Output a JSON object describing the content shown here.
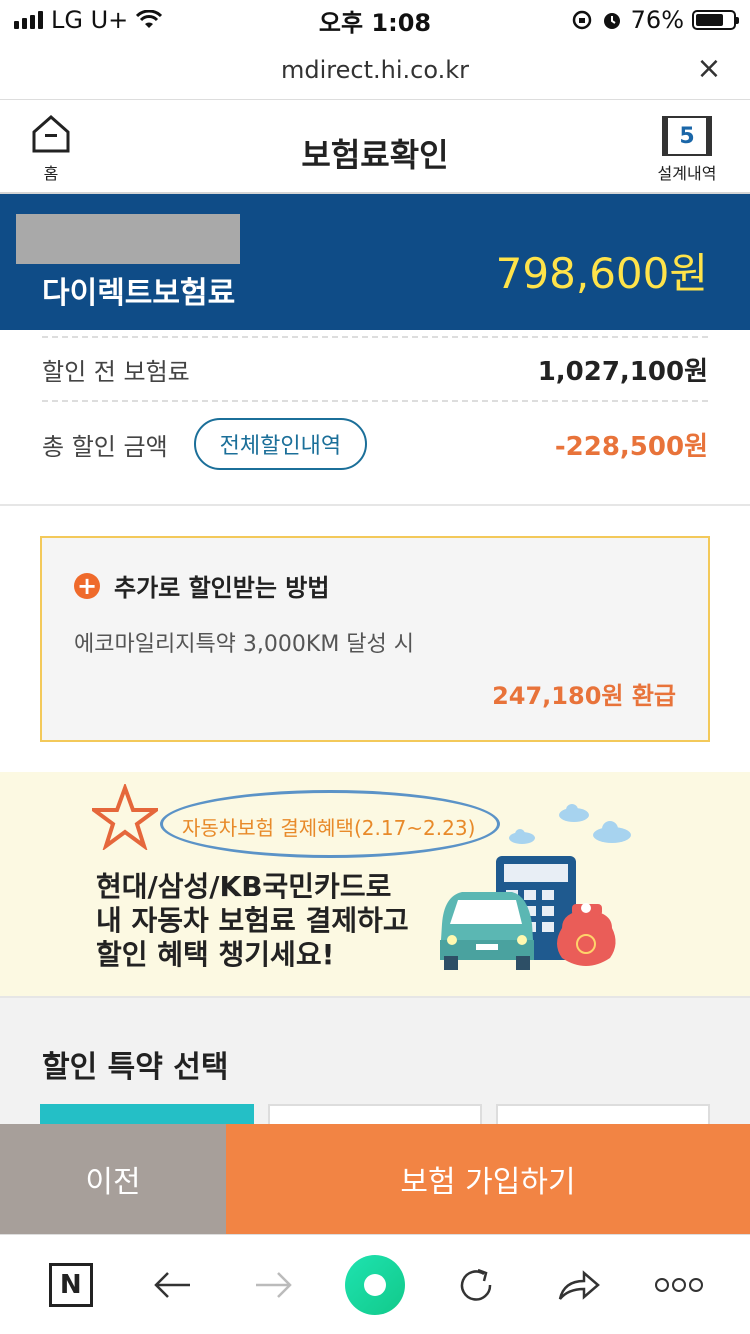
{
  "status_bar": {
    "carrier": "LG U+",
    "time": "오후 1:08",
    "battery_percent": "76%",
    "battery_level": 0.76
  },
  "url_bar": {
    "url": "mdirect.hi.co.kr",
    "close_icon": "close-icon"
  },
  "header": {
    "home_label": "홈",
    "title": "보험료확인",
    "quote_count": "5",
    "quote_label": "설계내역"
  },
  "premium": {
    "label": "다이렉트보험료",
    "amount": "798,600원"
  },
  "breakdown": {
    "before_label": "할인 전 보험료",
    "before_value": "1,027,100원",
    "discount_label": "총 할인 금액",
    "discount_button": "전체할인내역",
    "discount_value": "-228,500원"
  },
  "tip": {
    "title": "추가로 할인받는 방법",
    "description": "에코마일리지특약 3,000KM 달성 시",
    "refund": "247,180원 환급"
  },
  "promo": {
    "tag": "자동차보험 결제혜택(2.17~2.23)",
    "lines": [
      "현대/삼성/KB국민카드로",
      "내 자동차 보험료 결제하고",
      "할인 혜택 챙기세요!"
    ]
  },
  "section": {
    "title": "할인 특약 선택"
  },
  "cta": {
    "prev_label": "이전",
    "join_label": "보험 가입하기"
  },
  "colors": {
    "brand_navy": "#0f4c87",
    "premium_yellow": "#ffe34a",
    "accent_orange": "#f28444",
    "discount_orange": "#e8733a",
    "prev_gray": "#a79f9a",
    "tip_border": "#f3c95a"
  }
}
